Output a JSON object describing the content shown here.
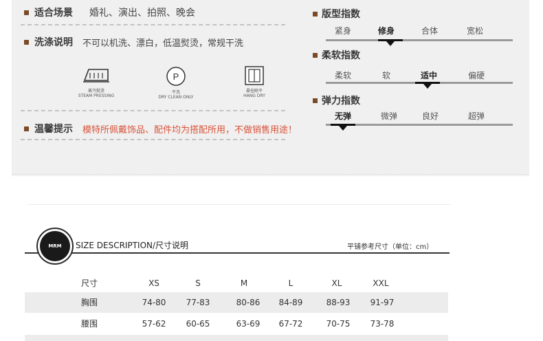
{
  "product_info": {
    "occasion": {
      "label": "适合场景",
      "value": "婚礼、演出、拍照、晚会"
    },
    "washing": {
      "label": "洗涤说明",
      "value": "不可以机洗、漂白，低温熨烫，常规干洗"
    },
    "notice": {
      "label": "温馨提示",
      "value": "模特所佩戴饰品、配件均为搭配所用，不做销售用途！"
    },
    "notice_color": "#d9533a"
  },
  "care_icons": [
    {
      "icon": "steam-iron-icon",
      "label": "蒸汽熨烫\nSTEAM PRESSING"
    },
    {
      "icon": "dry-clean-icon",
      "label": "干洗\nDRY CLEAN ONLY",
      "symbol": "P"
    },
    {
      "icon": "hang-dry-icon",
      "label": "悬挂晾干\nHANG DRY"
    }
  ],
  "indices": [
    {
      "title": "版型指数",
      "options": [
        "紧身",
        "修身",
        "合体",
        "宽松"
      ],
      "selected": 1
    },
    {
      "title": "柔软指数",
      "options": [
        "柔软",
        "软",
        "适中",
        "偏硬"
      ],
      "selected": 2
    },
    {
      "title": "弹力指数",
      "options": [
        "无弹",
        "微弹",
        "良好",
        "超弹"
      ],
      "selected": 0
    }
  ],
  "size_section": {
    "logo_text": "MRM",
    "title": "SIZE DESCRIPTION/尺寸说明",
    "note": "平铺参考尺寸（单位：cm）"
  },
  "size_table": {
    "headers": [
      "尺寸",
      "XS",
      "S",
      "M",
      "L",
      "XL",
      "XXL"
    ],
    "rows": [
      [
        "胸围",
        "74-80",
        "77-83",
        "80-86",
        "84-89",
        "88-93",
        "91-97"
      ],
      [
        "腰围",
        "57-62",
        "60-65",
        "63-69",
        "67-72",
        "70-75",
        "73-78"
      ]
    ]
  }
}
